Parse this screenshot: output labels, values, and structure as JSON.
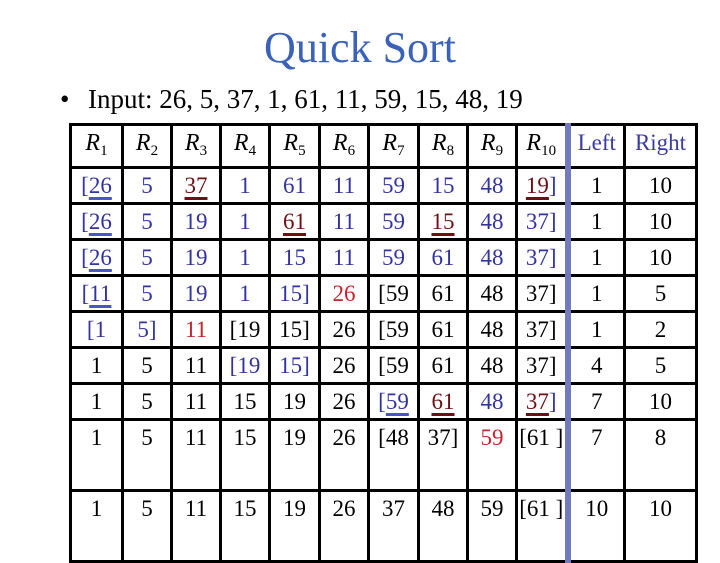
{
  "title": "Quick Sort",
  "input": {
    "bullet": "•",
    "label": "Input: 26, 5, 37, 1, 61, 11, 59, 15, 48, 19"
  },
  "colors": {
    "title": "#3A62B8",
    "blue": "#3333A0",
    "red": "#C0262C",
    "dark_red": "#6B1015",
    "separator": "#7379BF"
  },
  "table": {
    "headers": [
      {
        "sym": "R",
        "sub": "1"
      },
      {
        "sym": "R",
        "sub": "2"
      },
      {
        "sym": "R",
        "sub": "3"
      },
      {
        "sym": "R",
        "sub": "4"
      },
      {
        "sym": "R",
        "sub": "5"
      },
      {
        "sym": "R",
        "sub": "6"
      },
      {
        "sym": "R",
        "sub": "7"
      },
      {
        "sym": "R",
        "sub": "8"
      },
      {
        "sym": "R",
        "sub": "9"
      },
      {
        "sym": "R",
        "sub": "10"
      }
    ],
    "left_header": "Left",
    "right_header": "Right",
    "rows": [
      {
        "cells": [
          [
            {
              "t": "[",
              "c": "b"
            },
            {
              "t": "26",
              "c": "ub"
            }
          ],
          [
            {
              "t": "5",
              "c": "b"
            }
          ],
          [
            {
              "t": "37",
              "c": "ur"
            }
          ],
          [
            {
              "t": "1",
              "c": "b"
            }
          ],
          [
            {
              "t": "61",
              "c": "b"
            }
          ],
          [
            {
              "t": "11",
              "c": "b"
            }
          ],
          [
            {
              "t": "59",
              "c": "b"
            }
          ],
          [
            {
              "t": "15",
              "c": "b"
            }
          ],
          [
            {
              "t": "48",
              "c": "b"
            }
          ],
          [
            {
              "t": "19",
              "c": "ur"
            },
            {
              "t": "]",
              "c": "b"
            }
          ]
        ],
        "left": "1",
        "right": "10"
      },
      {
        "cells": [
          [
            {
              "t": "[",
              "c": "b"
            },
            {
              "t": "26",
              "c": "ub"
            }
          ],
          [
            {
              "t": "5",
              "c": "b"
            }
          ],
          [
            {
              "t": "19",
              "c": "b"
            }
          ],
          [
            {
              "t": "1",
              "c": "b"
            }
          ],
          [
            {
              "t": "61",
              "c": "ur"
            }
          ],
          [
            {
              "t": "11",
              "c": "b"
            }
          ],
          [
            {
              "t": "59",
              "c": "b"
            }
          ],
          [
            {
              "t": "15",
              "c": "ur"
            }
          ],
          [
            {
              "t": "48",
              "c": "b"
            }
          ],
          [
            {
              "t": "37]",
              "c": "b"
            }
          ]
        ],
        "left": "1",
        "right": "10"
      },
      {
        "cells": [
          [
            {
              "t": "[",
              "c": "b"
            },
            {
              "t": "26",
              "c": "ub"
            }
          ],
          [
            {
              "t": "5",
              "c": "b"
            }
          ],
          [
            {
              "t": "19",
              "c": "b"
            }
          ],
          [
            {
              "t": "1",
              "c": "b"
            }
          ],
          [
            {
              "t": "15",
              "c": "b"
            }
          ],
          [
            {
              "t": "11",
              "c": "b"
            }
          ],
          [
            {
              "t": "59",
              "c": "b"
            }
          ],
          [
            {
              "t": "61",
              "c": "b"
            }
          ],
          [
            {
              "t": "48",
              "c": "b"
            }
          ],
          [
            {
              "t": "37]",
              "c": "b"
            }
          ]
        ],
        "left": "1",
        "right": "10"
      },
      {
        "cells": [
          [
            {
              "t": "[",
              "c": "b"
            },
            {
              "t": "11",
              "c": "ub"
            }
          ],
          [
            {
              "t": "5",
              "c": "b"
            }
          ],
          [
            {
              "t": "19",
              "c": "b"
            }
          ],
          [
            {
              "t": "1",
              "c": "b"
            }
          ],
          [
            {
              "t": "15]",
              "c": "b"
            }
          ],
          [
            {
              "t": "26",
              "c": "r"
            }
          ],
          [
            {
              "t": "[59",
              "c": "k"
            }
          ],
          [
            {
              "t": "61",
              "c": "k"
            }
          ],
          [
            {
              "t": "48",
              "c": "k"
            }
          ],
          [
            {
              "t": "37]",
              "c": "k"
            }
          ]
        ],
        "left": "1",
        "right": "5"
      },
      {
        "cells": [
          [
            {
              "t": "[1",
              "c": "b"
            }
          ],
          [
            {
              "t": "5]",
              "c": "b"
            }
          ],
          [
            {
              "t": "11",
              "c": "r"
            }
          ],
          [
            {
              "t": "[19",
              "c": "k"
            }
          ],
          [
            {
              "t": "15]",
              "c": "k"
            }
          ],
          [
            {
              "t": "26",
              "c": "k"
            }
          ],
          [
            {
              "t": "[59",
              "c": "k"
            }
          ],
          [
            {
              "t": "61",
              "c": "k"
            }
          ],
          [
            {
              "t": "48",
              "c": "k"
            }
          ],
          [
            {
              "t": "37]",
              "c": "k"
            }
          ]
        ],
        "left": "1",
        "right": "2"
      },
      {
        "cells": [
          [
            {
              "t": "1",
              "c": "k"
            }
          ],
          [
            {
              "t": "5",
              "c": "k"
            }
          ],
          [
            {
              "t": "11",
              "c": "k"
            }
          ],
          [
            {
              "t": "[19",
              "c": "b"
            }
          ],
          [
            {
              "t": "15]",
              "c": "b"
            }
          ],
          [
            {
              "t": "26",
              "c": "k"
            }
          ],
          [
            {
              "t": "[59",
              "c": "k"
            }
          ],
          [
            {
              "t": "61",
              "c": "k"
            }
          ],
          [
            {
              "t": "48",
              "c": "k"
            }
          ],
          [
            {
              "t": "37]",
              "c": "k"
            }
          ]
        ],
        "left": "4",
        "right": "5"
      },
      {
        "cells": [
          [
            {
              "t": "1",
              "c": "k"
            }
          ],
          [
            {
              "t": "5",
              "c": "k"
            }
          ],
          [
            {
              "t": "11",
              "c": "k"
            }
          ],
          [
            {
              "t": "15",
              "c": "k"
            }
          ],
          [
            {
              "t": "19",
              "c": "k"
            }
          ],
          [
            {
              "t": "26",
              "c": "k"
            }
          ],
          [
            {
              "t": "[",
              "c": "b"
            },
            {
              "t": "59",
              "c": "ub"
            }
          ],
          [
            {
              "t": "61",
              "c": "ur"
            }
          ],
          [
            {
              "t": "48",
              "c": "b"
            }
          ],
          [
            {
              "t": "37",
              "c": "ur"
            },
            {
              "t": "]",
              "c": "b"
            }
          ]
        ],
        "left": "7",
        "right": "10"
      },
      {
        "tall": true,
        "cells": [
          [
            {
              "t": "1",
              "c": "k"
            }
          ],
          [
            {
              "t": "5",
              "c": "k"
            }
          ],
          [
            {
              "t": "11",
              "c": "k"
            }
          ],
          [
            {
              "t": "15",
              "c": "k"
            }
          ],
          [
            {
              "t": "19",
              "c": "k"
            }
          ],
          [
            {
              "t": "26",
              "c": "k"
            }
          ],
          [
            {
              "t": "[48",
              "c": "k"
            }
          ],
          [
            {
              "t": "37]",
              "c": "k"
            }
          ],
          [
            {
              "t": "59",
              "c": "r"
            }
          ],
          [
            {
              "t": "[61 ]",
              "c": "k"
            }
          ]
        ],
        "left": "7",
        "right": "8"
      },
      {
        "tall": true,
        "cells": [
          [
            {
              "t": "1",
              "c": "k"
            }
          ],
          [
            {
              "t": "5",
              "c": "k"
            }
          ],
          [
            {
              "t": "11",
              "c": "k"
            }
          ],
          [
            {
              "t": "15",
              "c": "k"
            }
          ],
          [
            {
              "t": "19",
              "c": "k"
            }
          ],
          [
            {
              "t": "26",
              "c": "k"
            }
          ],
          [
            {
              "t": "37",
              "c": "k"
            }
          ],
          [
            {
              "t": "48",
              "c": "k"
            }
          ],
          [
            {
              "t": "59",
              "c": "k"
            }
          ],
          [
            {
              "t": "[61 ]",
              "c": "k"
            }
          ]
        ],
        "left": "10",
        "right": "10"
      }
    ]
  }
}
